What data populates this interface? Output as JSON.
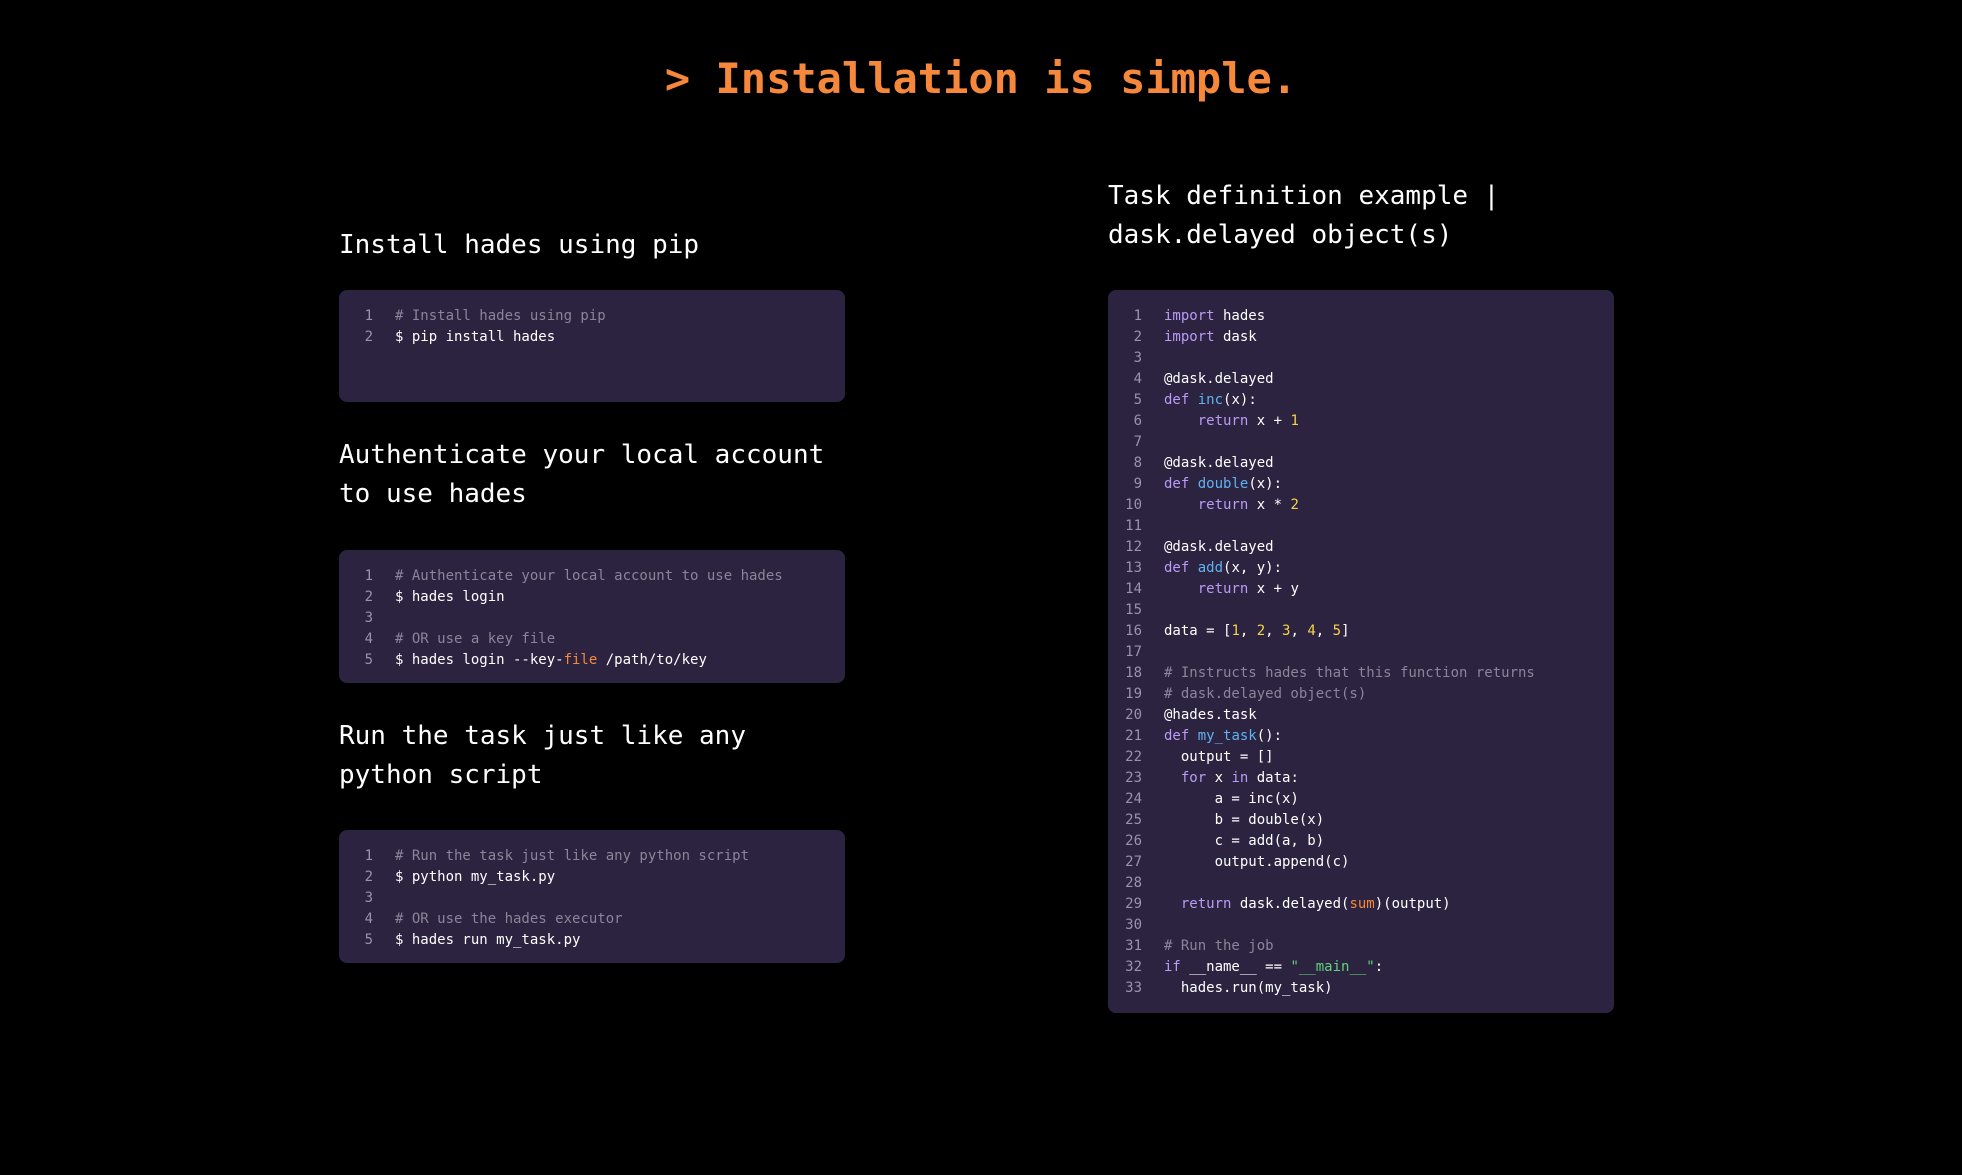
{
  "page": {
    "title": "> Installation is simple."
  },
  "colors": {
    "accent": "#f5883a",
    "background": "#000000",
    "code_bg": "#2b2340",
    "comment": "#8b8599",
    "keyword": "#b89cf5",
    "function": "#5fb3f0",
    "number": "#f5d547",
    "string": "#5fd47a",
    "builtin": "#f5883a"
  },
  "sections": {
    "install": {
      "heading": "Install hades using pip",
      "lines": [
        [
          {
            "t": "comment",
            "v": "# Install hades using pip"
          }
        ],
        [
          {
            "t": "plain",
            "v": "$ pip install hades"
          }
        ]
      ]
    },
    "auth": {
      "heading": "Authenticate your local account\nto use hades",
      "lines": [
        [
          {
            "t": "comment",
            "v": "# Authenticate your local account to use hades"
          }
        ],
        [
          {
            "t": "plain",
            "v": "$ hades login"
          }
        ],
        [],
        [
          {
            "t": "comment",
            "v": "# OR use a key file"
          }
        ],
        [
          {
            "t": "plain",
            "v": "$ hades login --key-"
          },
          {
            "t": "builtin",
            "v": "file"
          },
          {
            "t": "plain",
            "v": " /path/to/key"
          }
        ]
      ]
    },
    "run": {
      "heading": "Run the task just like any\npython script",
      "lines": [
        [
          {
            "t": "comment",
            "v": "# Run the task just like any python script"
          }
        ],
        [
          {
            "t": "plain",
            "v": "$ python my_task.py"
          }
        ],
        [],
        [
          {
            "t": "comment",
            "v": "# OR use the hades executor"
          }
        ],
        [
          {
            "t": "plain",
            "v": "$ hades run my_task.py"
          }
        ]
      ]
    },
    "task": {
      "heading": "Task definition example |\ndask.delayed object(s)",
      "lines": [
        [
          {
            "t": "kw",
            "v": "import"
          },
          {
            "t": "plain",
            "v": " hades"
          }
        ],
        [
          {
            "t": "kw",
            "v": "import"
          },
          {
            "t": "plain",
            "v": " dask"
          }
        ],
        [],
        [
          {
            "t": "plain",
            "v": "@dask.delayed"
          }
        ],
        [
          {
            "t": "kw",
            "v": "def"
          },
          {
            "t": "plain",
            "v": " "
          },
          {
            "t": "fn",
            "v": "inc"
          },
          {
            "t": "plain",
            "v": "(x):"
          }
        ],
        [
          {
            "t": "plain",
            "v": "    "
          },
          {
            "t": "kw",
            "v": "return"
          },
          {
            "t": "plain",
            "v": " x + "
          },
          {
            "t": "num",
            "v": "1"
          }
        ],
        [],
        [
          {
            "t": "plain",
            "v": "@dask.delayed"
          }
        ],
        [
          {
            "t": "kw",
            "v": "def"
          },
          {
            "t": "plain",
            "v": " "
          },
          {
            "t": "fn",
            "v": "double"
          },
          {
            "t": "plain",
            "v": "(x):"
          }
        ],
        [
          {
            "t": "plain",
            "v": "    "
          },
          {
            "t": "kw",
            "v": "return"
          },
          {
            "t": "plain",
            "v": " x * "
          },
          {
            "t": "num",
            "v": "2"
          }
        ],
        [],
        [
          {
            "t": "plain",
            "v": "@dask.delayed"
          }
        ],
        [
          {
            "t": "kw",
            "v": "def"
          },
          {
            "t": "plain",
            "v": " "
          },
          {
            "t": "fn",
            "v": "add"
          },
          {
            "t": "plain",
            "v": "(x, y):"
          }
        ],
        [
          {
            "t": "plain",
            "v": "    "
          },
          {
            "t": "kw",
            "v": "return"
          },
          {
            "t": "plain",
            "v": " x + y"
          }
        ],
        [],
        [
          {
            "t": "plain",
            "v": "data = ["
          },
          {
            "t": "num",
            "v": "1"
          },
          {
            "t": "plain",
            "v": ", "
          },
          {
            "t": "num",
            "v": "2"
          },
          {
            "t": "plain",
            "v": ", "
          },
          {
            "t": "num",
            "v": "3"
          },
          {
            "t": "plain",
            "v": ", "
          },
          {
            "t": "num",
            "v": "4"
          },
          {
            "t": "plain",
            "v": ", "
          },
          {
            "t": "num",
            "v": "5"
          },
          {
            "t": "plain",
            "v": "]"
          }
        ],
        [],
        [
          {
            "t": "comment",
            "v": "# Instructs hades that this function returns"
          }
        ],
        [
          {
            "t": "comment",
            "v": "# dask.delayed object(s)"
          }
        ],
        [
          {
            "t": "plain",
            "v": "@hades.task"
          }
        ],
        [
          {
            "t": "kw",
            "v": "def"
          },
          {
            "t": "plain",
            "v": " "
          },
          {
            "t": "fn",
            "v": "my_task"
          },
          {
            "t": "plain",
            "v": "():"
          }
        ],
        [
          {
            "t": "plain",
            "v": "  output = []"
          }
        ],
        [
          {
            "t": "plain",
            "v": "  "
          },
          {
            "t": "kw",
            "v": "for"
          },
          {
            "t": "plain",
            "v": " x "
          },
          {
            "t": "kw",
            "v": "in"
          },
          {
            "t": "plain",
            "v": " data:"
          }
        ],
        [
          {
            "t": "plain",
            "v": "      a = inc(x)"
          }
        ],
        [
          {
            "t": "plain",
            "v": "      b = double(x)"
          }
        ],
        [
          {
            "t": "plain",
            "v": "      c = add(a, b)"
          }
        ],
        [
          {
            "t": "plain",
            "v": "      output.append(c)"
          }
        ],
        [],
        [
          {
            "t": "plain",
            "v": "  "
          },
          {
            "t": "kw",
            "v": "return"
          },
          {
            "t": "plain",
            "v": " dask.delayed("
          },
          {
            "t": "builtin",
            "v": "sum"
          },
          {
            "t": "plain",
            "v": ")(output)"
          }
        ],
        [],
        [
          {
            "t": "comment",
            "v": "# Run the job"
          }
        ],
        [
          {
            "t": "kw",
            "v": "if"
          },
          {
            "t": "plain",
            "v": " __name__ == "
          },
          {
            "t": "str",
            "v": "\"__main__\""
          },
          {
            "t": "plain",
            "v": ":"
          }
        ],
        [
          {
            "t": "plain",
            "v": "  hades.run(my_task)"
          }
        ]
      ]
    }
  }
}
